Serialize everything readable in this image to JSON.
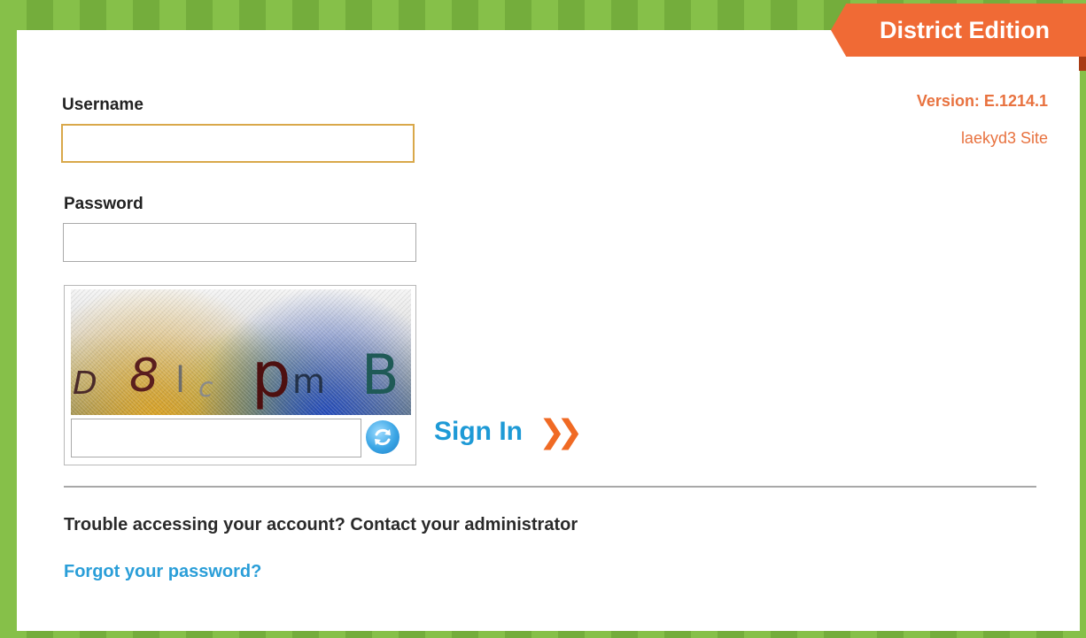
{
  "edition_banner": "District Edition",
  "version": "Version: E.1214.1",
  "site": "laekyd3 Site",
  "form": {
    "username_label": "Username",
    "username_value": "",
    "password_label": "Password",
    "password_value": "",
    "captcha_chars": [
      "D",
      "8",
      "l",
      "c",
      "p",
      "m",
      "B"
    ],
    "captcha_value": "",
    "sign_in_label": "Sign In",
    "sign_in_chevrons": "❯❯"
  },
  "help": {
    "trouble_text": "Trouble accessing your account? Contact your administrator",
    "forgot_link": "Forgot your password?"
  },
  "colors": {
    "frame_green": "#7cb542",
    "banner_orange": "#f06a35",
    "link_blue": "#2a9ed8",
    "accent_orange": "#e8723f"
  },
  "icons": {
    "refresh": "refresh-icon",
    "chevrons": "double-chevron-right-icon"
  }
}
